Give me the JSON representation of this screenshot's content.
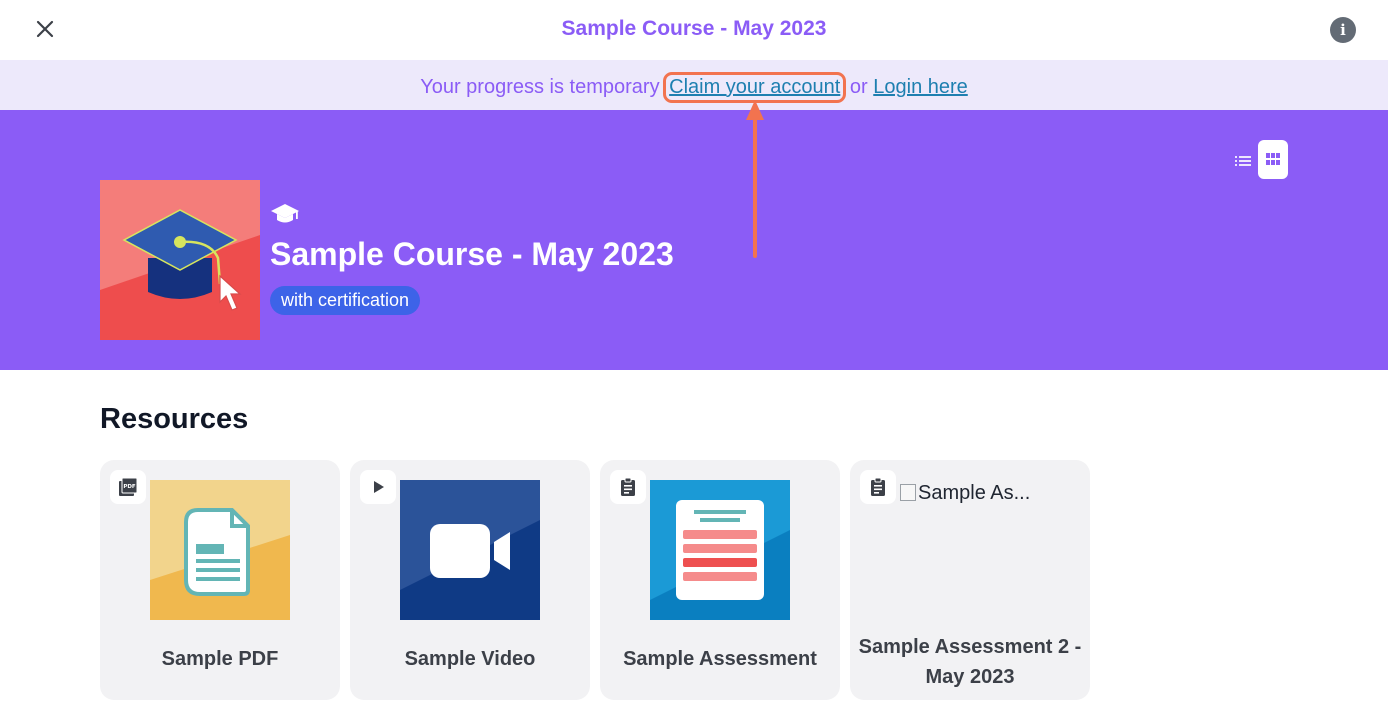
{
  "header": {
    "title": "Sample Course - May 2023",
    "close_icon": "close-icon",
    "info_icon": "info-icon",
    "info_glyph": "i"
  },
  "notice": {
    "text": "Your progress is temporary",
    "claim_link": "Claim your account",
    "separator": "or",
    "login_link": "Login here"
  },
  "course": {
    "title": "Sample Course - May 2023",
    "badge": "with certification",
    "type_icon": "graduation-cap-icon"
  },
  "resources": {
    "title": "Resources",
    "items": [
      {
        "label": "Sample PDF",
        "type_icon": "pdf-icon"
      },
      {
        "label": "Sample Video",
        "type_icon": "play-icon"
      },
      {
        "label": "Sample Assessment",
        "type_icon": "clipboard-icon"
      },
      {
        "label": "Sample Assessment 2 - May 2023",
        "type_icon": "clipboard-icon",
        "image_alt": "Sample As..."
      }
    ]
  },
  "colors": {
    "brand_purple": "#8b5cf6",
    "notice_bg": "#ede9fb",
    "link": "#1e7fb0",
    "highlight": "#f2734f",
    "badge_blue": "#3d63e8"
  }
}
